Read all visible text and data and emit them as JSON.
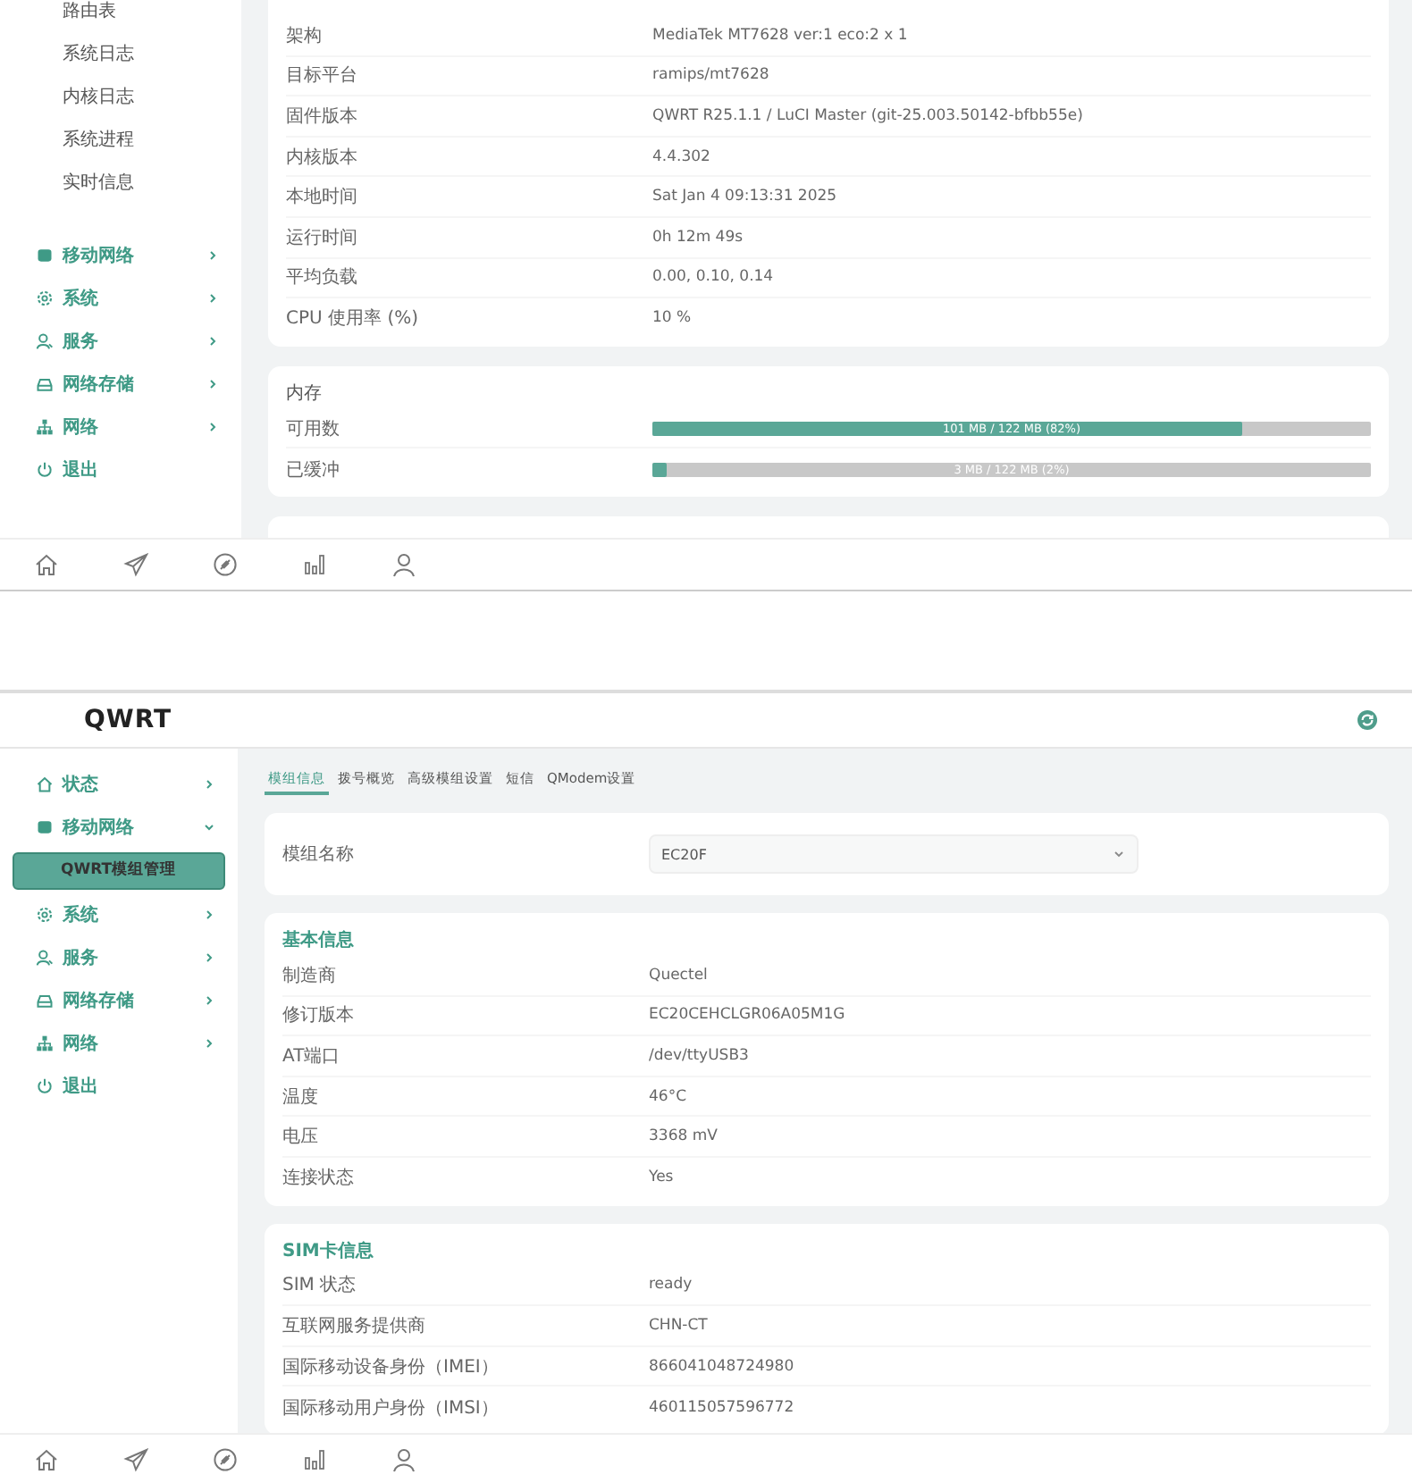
{
  "top_screen": {
    "sidebar": {
      "subitems": [
        "路由表",
        "系统日志",
        "内核日志",
        "系统进程",
        "实时信息"
      ],
      "items": [
        {
          "label": "移动网络",
          "expanded": false
        },
        {
          "label": "系统",
          "expanded": false
        },
        {
          "label": "服务",
          "expanded": false
        },
        {
          "label": "网络存储",
          "expanded": false
        },
        {
          "label": "网络",
          "expanded": false
        },
        {
          "label": "退出"
        }
      ]
    },
    "system_rows": [
      {
        "label": "架构",
        "value": "MediaTek MT7628 ver:1 eco:2 x 1"
      },
      {
        "label": "目标平台",
        "value": "ramips/mt7628"
      },
      {
        "label": "固件版本",
        "value": "QWRT R25.1.1 / LuCI Master (git-25.003.50142-bfbb55e)"
      },
      {
        "label": "内核版本",
        "value": "4.4.302"
      },
      {
        "label": "本地时间",
        "value": "Sat Jan 4 09:13:31 2025"
      },
      {
        "label": "运行时间",
        "value": "0h 12m 49s"
      },
      {
        "label": "平均负载",
        "value": "0.00, 0.10, 0.14"
      },
      {
        "label": "CPU 使用率 (%)",
        "value": "10 %"
      }
    ],
    "memory": {
      "title": "内存",
      "rows": [
        {
          "label": "可用数",
          "level": 0.82,
          "reading": "101 MB / 122 MB (82%)"
        },
        {
          "label": "已缓冲",
          "level": 0.02,
          "reading": "3 MB / 122 MB (2%)"
        }
      ]
    }
  },
  "bottom_screen": {
    "logo": "QWRT",
    "sidebar": {
      "items": [
        {
          "label": "状态",
          "expanded": false
        },
        {
          "label": "移动网络",
          "expanded": true,
          "children": [
            {
              "label": "QWRT模组管理",
              "selected": true
            }
          ]
        },
        {
          "label": "系统",
          "expanded": false
        },
        {
          "label": "服务",
          "expanded": false
        },
        {
          "label": "网络存储",
          "expanded": false
        },
        {
          "label": "网络",
          "expanded": false
        },
        {
          "label": "退出"
        }
      ]
    },
    "tabs": [
      {
        "label": "模组信息",
        "selected": true
      },
      {
        "label": "拨号概览",
        "selected": false
      },
      {
        "label": "高级模组设置",
        "selected": false
      },
      {
        "label": "短信",
        "selected": false
      },
      {
        "label": "QModem设置",
        "selected": false
      }
    ],
    "module_select": {
      "label": "模组名称",
      "value": "EC20F"
    },
    "sections": [
      {
        "title": "基本信息",
        "rows": [
          {
            "label": "制造商",
            "value": "Quectel"
          },
          {
            "label": "修订版本",
            "value": "EC20CEHCLGR06A05M1G"
          },
          {
            "label": "AT端口",
            "value": "/dev/ttyUSB3"
          },
          {
            "label": "温度",
            "value": "46°C"
          },
          {
            "label": "电压",
            "value": "3368 mV"
          },
          {
            "label": "连接状态",
            "value": "Yes"
          }
        ]
      },
      {
        "title": "SIM卡信息",
        "rows": [
          {
            "label": "SIM 状态",
            "value": "ready"
          },
          {
            "label": "互联网服务提供商",
            "value": "CHN-CT"
          },
          {
            "label": "国际移动设备身份（IMEI）",
            "value": "866041048724980"
          },
          {
            "label": "国际移动用户身份（IMSI）",
            "value": "460115057596772"
          }
        ]
      }
    ]
  }
}
